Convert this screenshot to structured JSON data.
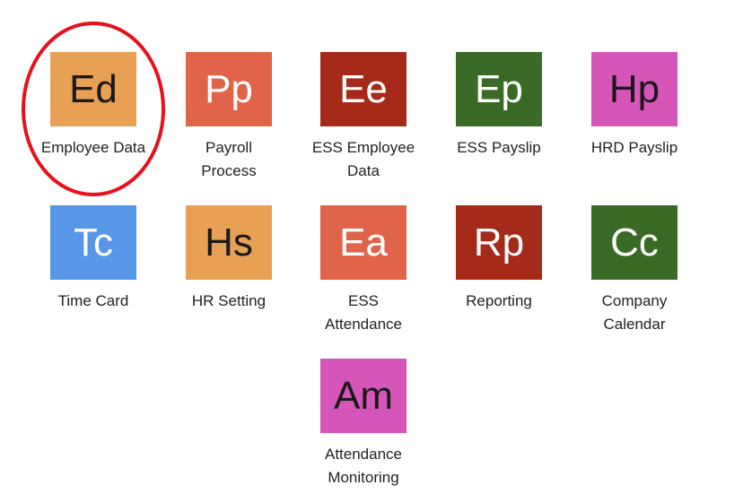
{
  "apps": [
    {
      "abbr": "Ed",
      "label": "Employee Data",
      "bg": "#e8a055",
      "fg": "#1a1a1a",
      "icon": "employee-data-icon"
    },
    {
      "abbr": "Pp",
      "label": "Payroll Process",
      "bg": "#e0644a",
      "fg": "#ffffff",
      "icon": "payroll-process-icon"
    },
    {
      "abbr": "Ee",
      "label": "ESS Employee Data",
      "bg": "#a52a1a",
      "fg": "#ffffff",
      "icon": "ess-employee-data-icon"
    },
    {
      "abbr": "Ep",
      "label": "ESS Payslip",
      "bg": "#3a6b26",
      "fg": "#ffffff",
      "icon": "ess-payslip-icon"
    },
    {
      "abbr": "Hp",
      "label": "HRD Payslip",
      "bg": "#d655b9",
      "fg": "#1a1a1a",
      "icon": "hrd-payslip-icon"
    },
    {
      "abbr": "Tc",
      "label": "Time Card",
      "bg": "#5897e8",
      "fg": "#ffffff",
      "icon": "time-card-icon"
    },
    {
      "abbr": "Hs",
      "label": "HR Setting",
      "bg": "#e8a055",
      "fg": "#1a1a1a",
      "icon": "hr-setting-icon"
    },
    {
      "abbr": "Ea",
      "label": "ESS Attendance",
      "bg": "#e0644a",
      "fg": "#ffffff",
      "icon": "ess-attendance-icon"
    },
    {
      "abbr": "Rp",
      "label": "Reporting",
      "bg": "#a52a1a",
      "fg": "#ffffff",
      "icon": "reporting-icon"
    },
    {
      "abbr": "Cc",
      "label": "Company Calendar",
      "bg": "#3a6b26",
      "fg": "#ffffff",
      "icon": "company-calendar-icon"
    },
    {
      "abbr": "Am",
      "label": "Attendance Monitoring",
      "bg": "#d655b9",
      "fg": "#1a1a1a",
      "icon": "attendance-monitoring-icon"
    }
  ],
  "highlight": {
    "color": "#e8101b",
    "target": "Employee Data"
  }
}
